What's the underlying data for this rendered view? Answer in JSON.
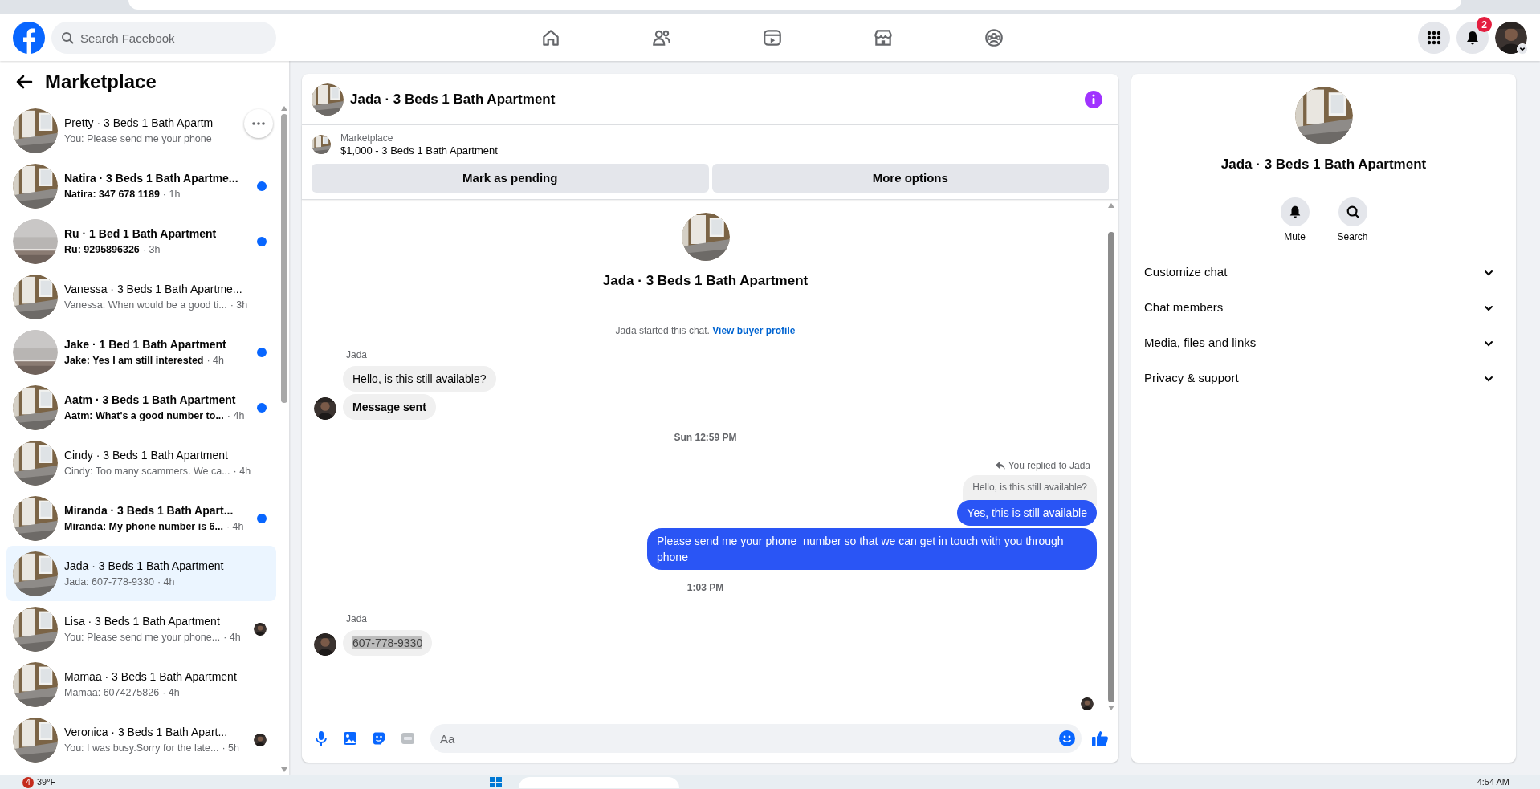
{
  "topbar": {
    "search": {
      "placeholder": "Search Facebook"
    },
    "nav": [
      {
        "kind": "home"
      },
      {
        "kind": "friends"
      },
      {
        "kind": "video"
      },
      {
        "kind": "marketplace"
      },
      {
        "kind": "groups"
      }
    ],
    "notifications_badge": "2"
  },
  "sidebar": {
    "title": "Marketplace",
    "conversations": [
      {
        "title": "Pretty · 3 Beds 1 Bath Apartm",
        "preview": "You: Please send me your phone",
        "unread": false,
        "selected": false,
        "read_receipt": false,
        "more_button": true
      },
      {
        "title": "Natira · 3 Beds 1 Bath Apartme...",
        "preview": "Natira: 347 678 1189",
        "time": "· 1h",
        "unread": true,
        "selected": false,
        "read_receipt": false,
        "more_button": false
      },
      {
        "title": "Ru · 1 Bed 1 Bath Apartment",
        "preview": "Ru: 9295896326",
        "time": "· 3h",
        "unread": true,
        "selected": false,
        "read_receipt": false,
        "more_button": false
      },
      {
        "title": "Vanessa · 3 Beds 1 Bath Apartme...",
        "preview": "Vanessa: When would be a good ti...",
        "time": "· 3h",
        "unread": false,
        "selected": false,
        "read_receipt": false,
        "more_button": false
      },
      {
        "title": "Jake · 1 Bed 1 Bath Apartment",
        "preview": "Jake: Yes I am still interested",
        "time": "· 4h",
        "unread": true,
        "selected": false,
        "read_receipt": false,
        "more_button": false
      },
      {
        "title": "Aatm · 3 Beds 1 Bath Apartment",
        "preview": "Aatm: What's a good number to...",
        "time": "· 4h",
        "unread": true,
        "selected": false,
        "read_receipt": false,
        "more_button": false
      },
      {
        "title": "Cindy · 3 Beds 1 Bath Apartment",
        "preview": "Cindy: Too many scammers. We ca...",
        "time": "· 4h",
        "unread": false,
        "selected": false,
        "read_receipt": false,
        "more_button": false
      },
      {
        "title": "Miranda · 3 Beds 1 Bath Apart...",
        "preview": "Miranda: My phone number is 6...",
        "time": "· 4h",
        "unread": true,
        "selected": false,
        "read_receipt": false,
        "more_button": false
      },
      {
        "title": "Jada · 3 Beds 1 Bath Apartment",
        "preview": "Jada: 607-778-9330",
        "time": "· 4h",
        "unread": false,
        "selected": true,
        "read_receipt": false,
        "more_button": false
      },
      {
        "title": "Lisa · 3 Beds 1 Bath Apartment",
        "preview": "You: Please send me your phone...",
        "time": "· 4h",
        "unread": false,
        "selected": false,
        "read_receipt": true,
        "more_button": false
      },
      {
        "title": "Mamaa · 3 Beds 1 Bath Apartment",
        "preview": "Mamaa: 6074275826",
        "time": "· 4h",
        "unread": false,
        "selected": false,
        "read_receipt": false,
        "more_button": false
      },
      {
        "title": "Veronica · 3 Beds 1 Bath Apart...",
        "preview": "You: I was busy.Sorry for the late...",
        "time": "· 5h",
        "unread": false,
        "selected": false,
        "read_receipt": true,
        "more_button": false
      }
    ]
  },
  "chat": {
    "title": "Jada · 3 Beds 1 Bath Apartment",
    "listing": {
      "label": "Marketplace",
      "text": "$1,000 - 3 Beds 1 Bath Apartment"
    },
    "buttons": [
      "Mark as pending",
      "More options"
    ],
    "intro_title": "Jada · 3 Beds 1 Bath Apartment",
    "intro_note": "Jada started this chat.",
    "intro_link": "View buyer profile",
    "messages": [
      {
        "kind": "sender",
        "text": "Jada"
      },
      {
        "kind": "incoming",
        "text": "Hello, is this still available?",
        "avatar": false,
        "bold": false
      },
      {
        "kind": "incoming",
        "text": "Message sent",
        "avatar": true,
        "bold": true
      },
      {
        "kind": "time",
        "text": "Sun 12:59 PM"
      },
      {
        "kind": "reply_note",
        "text": "You replied to Jada"
      },
      {
        "kind": "quoted",
        "text": "Hello, is this still available?"
      },
      {
        "kind": "outgoing",
        "text": "Yes, this is still available"
      },
      {
        "kind": "outgoing",
        "text": "Please send me your phone  number so that we can get in touch with you through phone"
      },
      {
        "kind": "time",
        "text": "1:03 PM"
      },
      {
        "kind": "sender",
        "text": "Jada"
      },
      {
        "kind": "incoming",
        "text": "607-778-9330",
        "avatar": true,
        "bold": false,
        "highlighted": true
      }
    ],
    "composer": {
      "placeholder": "Aa"
    }
  },
  "details": {
    "title": "Jada · 3 Beds 1 Bath Apartment",
    "actions": [
      {
        "kind": "mute",
        "label": "Mute"
      },
      {
        "kind": "search",
        "label": "Search"
      }
    ],
    "sections": [
      "Customize chat",
      "Chat members",
      "Media, files and links",
      "Privacy & support"
    ]
  },
  "taskbar": {
    "weather_badge": "4",
    "temperature": "39°F",
    "clock": "4:54 AM"
  }
}
